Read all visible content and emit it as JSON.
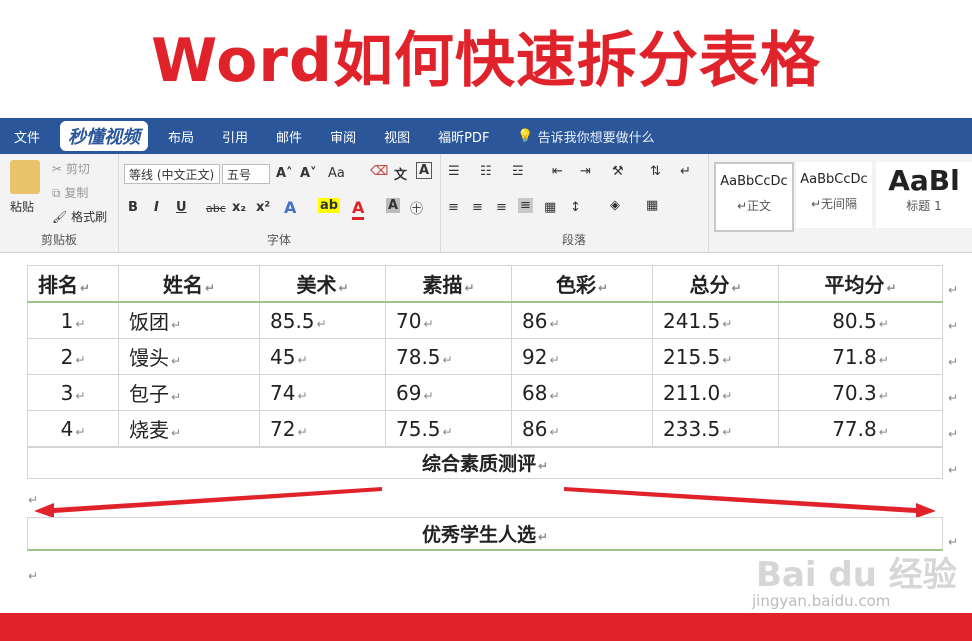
{
  "banner": {
    "title": "Word如何快速拆分表格"
  },
  "menubar": {
    "items": [
      "文件",
      "布局",
      "引用",
      "邮件",
      "审阅",
      "视图",
      "福昕PDF"
    ],
    "logo": "秒懂视频",
    "tell_me": "告诉我你想要做什么"
  },
  "ribbon": {
    "clipboard": {
      "paste": "粘贴",
      "cut": "剪切",
      "copy": "复制",
      "format_painter": "格式刷",
      "label": "剪贴板"
    },
    "font": {
      "font_name": "等线 (中文正文)",
      "font_size": "五号",
      "grow": "A˄",
      "shrink": "A˅",
      "case": "Aa",
      "bold": "B",
      "italic": "I",
      "underline": "U",
      "strike": "abc",
      "subscript": "x₂",
      "superscript": "x²",
      "label": "字体"
    },
    "paragraph": {
      "label": "段落"
    },
    "styles": [
      {
        "sample": "AaBbCcDc",
        "name": "↵正文"
      },
      {
        "sample": "AaBbCcDc",
        "name": "↵无间隔"
      },
      {
        "sample": "AaBl",
        "name": "标题 1"
      }
    ]
  },
  "table": {
    "headers": [
      "排名",
      "姓名",
      "美术",
      "素描",
      "色彩",
      "总分",
      "平均分"
    ],
    "rows": [
      [
        "1",
        "饭团",
        "85.5",
        "70",
        "86",
        "241.5",
        "80.5"
      ],
      [
        "2",
        "馒头",
        "45",
        "78.5",
        "92",
        "215.5",
        "71.8"
      ],
      [
        "3",
        "包子",
        "74",
        "69",
        "68",
        "211.0",
        "70.3"
      ],
      [
        "4",
        "烧麦",
        "72",
        "75.5",
        "86",
        "233.5",
        "77.8"
      ]
    ],
    "merged_row_1": "综合素质测评",
    "merged_row_2": "优秀学生人选"
  },
  "marks": {
    "cell_end": "↵"
  },
  "watermark": {
    "brand": "Bai du 经验",
    "url": "jingyan.baidu.com"
  },
  "colors": {
    "title_red": "#e0232b",
    "ribbon_blue": "#2b579a",
    "arrow_red": "#e0232b"
  }
}
